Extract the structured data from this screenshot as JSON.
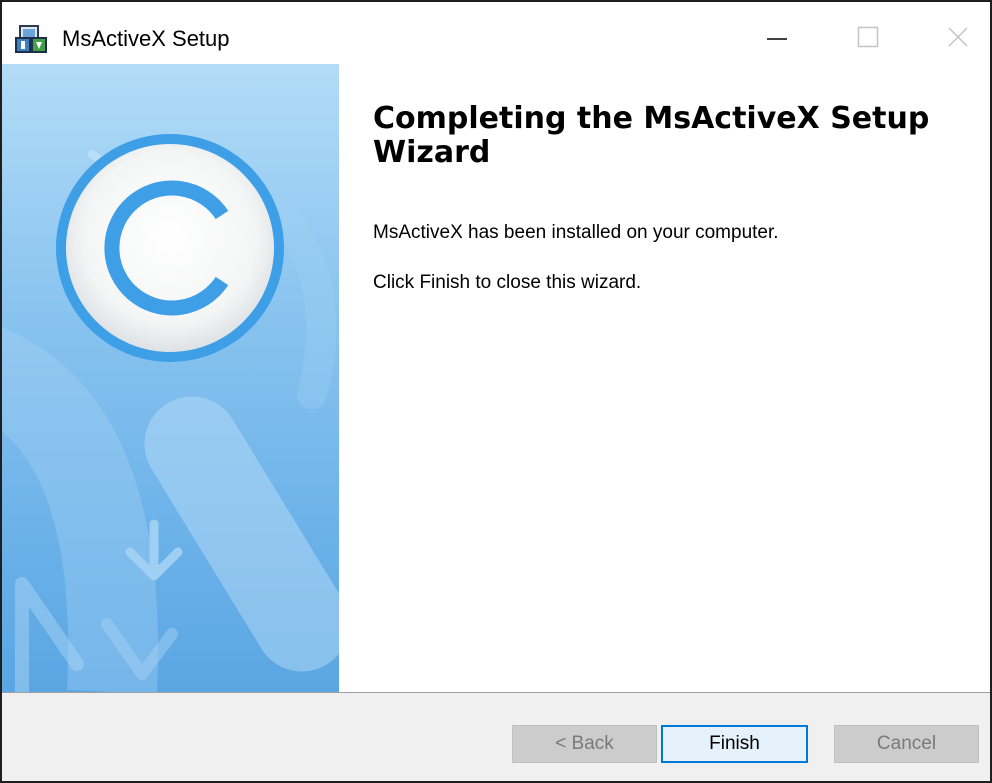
{
  "window": {
    "title": "MsActiveX Setup"
  },
  "content": {
    "heading": "Completing the MsActiveX Setup Wizard",
    "line1": "MsActiveX has been installed on your computer.",
    "line2": "Click Finish to close this wizard."
  },
  "buttons": {
    "back": "< Back",
    "finish": "Finish",
    "cancel": "Cancel"
  },
  "colors": {
    "accent": "#0078d7",
    "banner_top": "#b3dcf7",
    "banner_bottom": "#5aa6e3",
    "logo_ring": "#3e9ee6",
    "disabled_button": "#cccccc"
  },
  "icons": [
    "installer-app-icon",
    "minimize-icon",
    "maximize-icon",
    "close-icon",
    "installer-logo",
    "down-arrow-decoration"
  ]
}
